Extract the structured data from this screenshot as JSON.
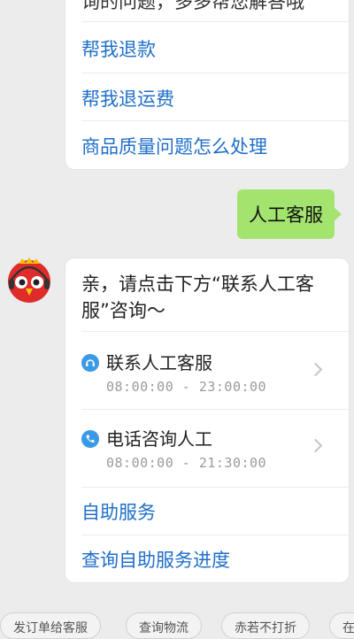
{
  "top_card": {
    "cut_text": "询的问题，多多帮您解答哦",
    "links": [
      "帮我退款",
      "帮我退运费",
      "商品质量问题怎么处理"
    ]
  },
  "user_message": "人工客服",
  "bot": {
    "message": "亲，请点击下方“联系人工客服”咨询～",
    "services": [
      {
        "name": "联系人工客服",
        "hours": "08:00:00 - 23:00:00",
        "icon": "headset-icon"
      },
      {
        "name": "电话咨询人工",
        "hours": "08:00:00 - 21:30:00",
        "icon": "phone-icon"
      }
    ],
    "links": [
      "自助服务",
      "查询自助服务进度"
    ]
  },
  "quick_replies": [
    "发订单给客服",
    "查询物流",
    "赤若不打折",
    "在"
  ],
  "colors": {
    "link": "#1f6fc8",
    "user_bubble": "#a3e46e",
    "icon": "#3b9ae6",
    "background": "#ececec"
  }
}
